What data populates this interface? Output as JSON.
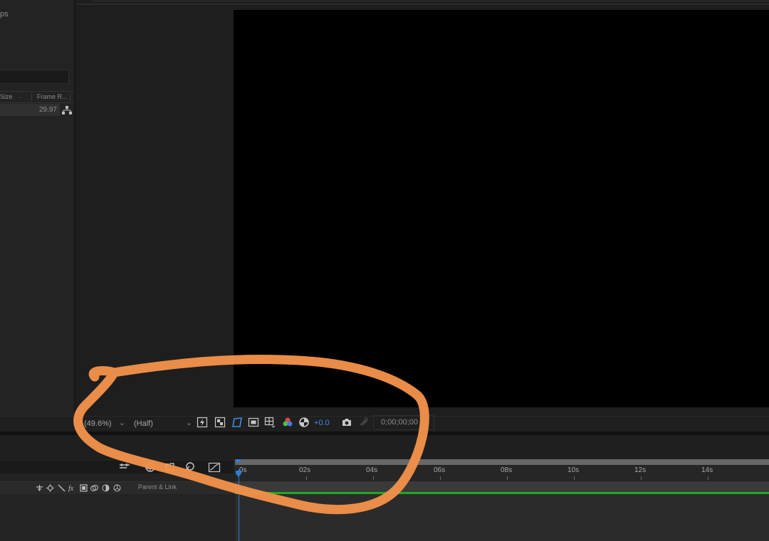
{
  "project_panel": {
    "title_fragment": "ps",
    "columns": {
      "size": "Size",
      "dot": ".",
      "frame_rate": "Frame R..."
    },
    "row": {
      "frame_rate": "29.97"
    }
  },
  "viewer_toolbar": {
    "magnification": "(49.6%)",
    "resolution": "(Half)",
    "exposure": "+0.0",
    "timecode": "0;00;00;00",
    "icons": [
      "region-of-interest-icon",
      "transparency-grid-icon",
      "mask-path-icon",
      "safe-zones-icon",
      "grid-guides-icon",
      "color-channel-icon",
      "color-management-icon",
      "snapshot-icon",
      "show-snapshot-icon"
    ]
  },
  "timeline": {
    "ruler_labels": [
      "0s",
      "02s",
      "04s",
      "06s",
      "08s",
      "10s",
      "12s",
      "14s"
    ],
    "layer_header": {
      "parent_link": "Parent & Link"
    },
    "switch_icons": [
      "shy-icon",
      "collapse-icon",
      "quality-icon",
      "fx-icon",
      "frame-blend-icon",
      "motion-blur-icon",
      "adjustment-icon",
      "3d-layer-icon"
    ],
    "toolbar_icons": [
      "composition-mini-flowchart-icon",
      "draft-3d-icon",
      "hide-shy-layers-icon",
      "frame-blending-icon",
      "motion-blur-icon",
      "graph-editor-icon"
    ]
  },
  "colors": {
    "accent_blue": "#3d8de4",
    "annotation_orange": "#f0914a",
    "layer_bar_green": "#1fa91f"
  }
}
